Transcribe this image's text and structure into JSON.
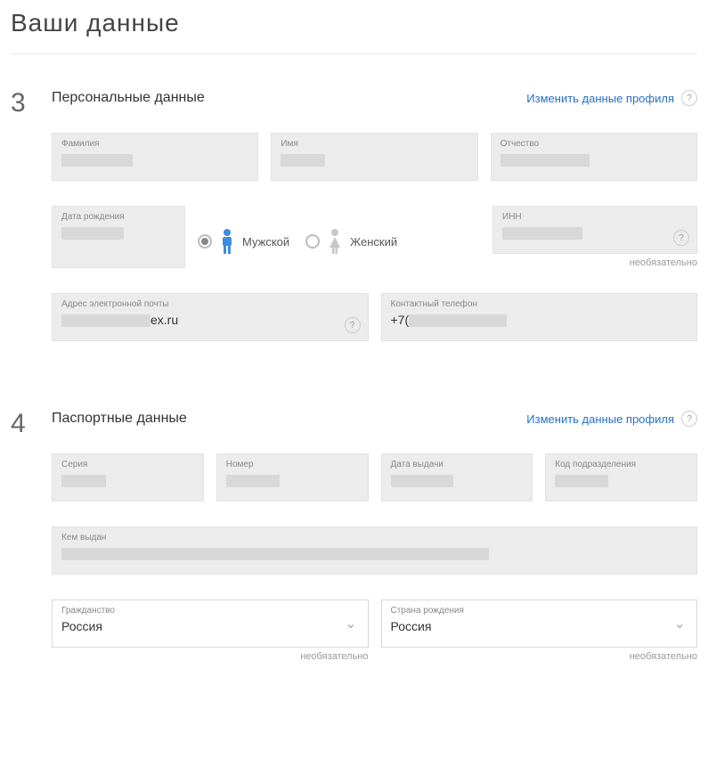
{
  "page_title": "Ваши данные",
  "section3": {
    "num": "3",
    "title": "Персональные данные",
    "edit_link": "Изменить данные профиля",
    "fields": {
      "lastname_label": "Фамилия",
      "firstname_label": "Имя",
      "patronymic_label": "Отчество",
      "dob_label": "Дата рождения",
      "inn_label": "ИНН",
      "inn_hint": "необязательно",
      "email_label": "Адрес электронной почты",
      "email_value_suffix": "ex.ru",
      "phone_label": "Контактный телефон",
      "phone_value_prefix": "+7("
    },
    "gender": {
      "male": "Мужской",
      "female": "Женский",
      "selected": "male"
    }
  },
  "section4": {
    "num": "4",
    "title": "Паспортные данные",
    "edit_link": "Изменить данные профиля",
    "fields": {
      "series_label": "Серия",
      "number_label": "Номер",
      "issue_date_label": "Дата выдачи",
      "dept_code_label": "Код подразделения",
      "issued_by_label": "Кем выдан",
      "citizenship_label": "Гражданство",
      "citizenship_value": "Россия",
      "citizenship_hint": "необязательно",
      "birth_country_label": "Страна рождения",
      "birth_country_value": "Россия",
      "birth_country_hint": "необязательно"
    }
  }
}
